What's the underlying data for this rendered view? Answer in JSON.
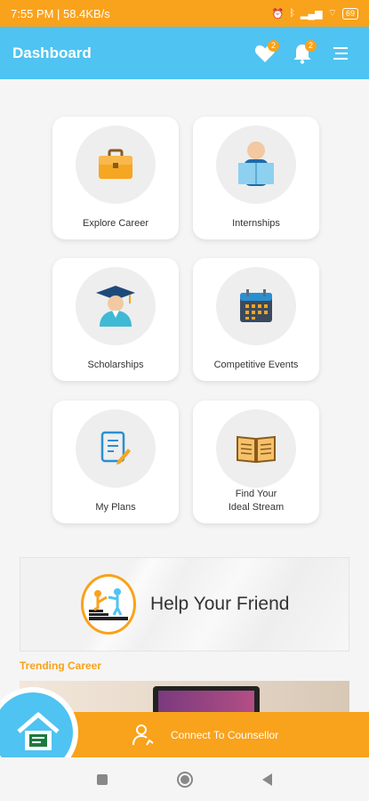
{
  "status": {
    "time_speed": "7:55 PM | 58.4KB/s",
    "battery": "69"
  },
  "header": {
    "title": "Dashboard",
    "favorites_count": "2",
    "notifications_count": "2"
  },
  "cards": [
    {
      "label": "Explore Career",
      "icon": "briefcase-icon"
    },
    {
      "label": "Internships",
      "icon": "reading-person-icon"
    },
    {
      "label": "Scholarships",
      "icon": "graduate-icon"
    },
    {
      "label": "Competitive Events",
      "icon": "calendar-icon"
    },
    {
      "label": "My Plans",
      "icon": "document-edit-icon"
    },
    {
      "label": "Find Your Ideal Stream",
      "label_line1": "Find Your",
      "label_line2": "Ideal Stream",
      "icon": "open-book-icon"
    }
  ],
  "banner": {
    "text": "Help Your Friend",
    "icon": "helping-hand-icon"
  },
  "trending": {
    "title": "Trending Career"
  },
  "bottom": {
    "counsellor_label": "Connect To Counsellor",
    "home_icon": "home-icon"
  },
  "colors": {
    "primary": "#4fc3f1",
    "accent": "#f9a21b"
  }
}
